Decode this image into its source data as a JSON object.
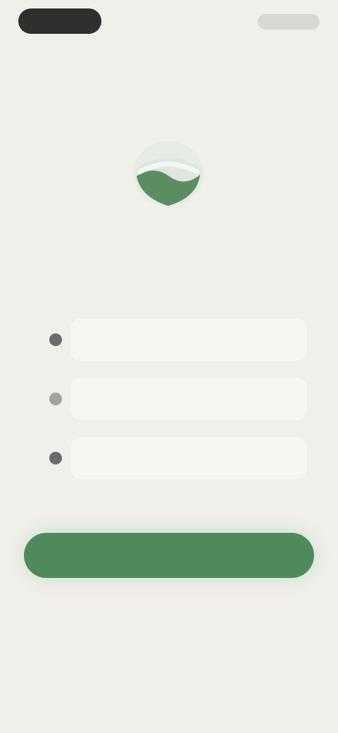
{
  "status_bar": {
    "time": "",
    "indicators": ""
  },
  "hero": {
    "icon": "leaf-badge-icon",
    "accent_color": "#4f8a5c"
  },
  "title": {
    "line1": "",
    "line2": ""
  },
  "choices": [
    {
      "label": "",
      "selected": false
    },
    {
      "label": "",
      "selected": false
    },
    {
      "label": "",
      "selected": false
    }
  ],
  "primary_button": {
    "label": "",
    "color": "#4f8a5c"
  },
  "footer": {
    "line1": "",
    "line2": ""
  }
}
